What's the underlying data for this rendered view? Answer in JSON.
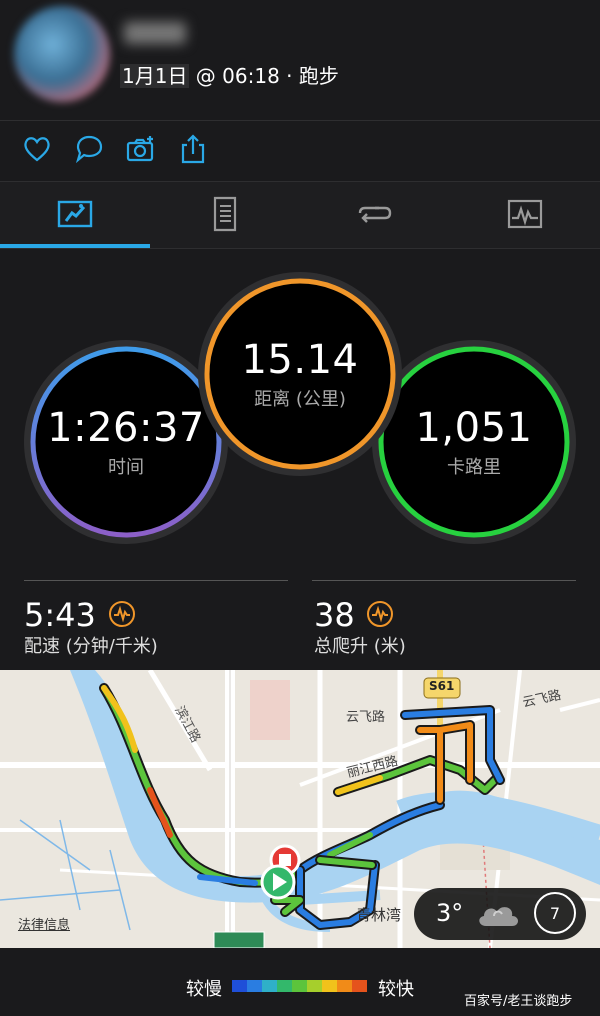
{
  "activity": {
    "date": "1月1日",
    "rest": " @ 06:18 · 跑步"
  },
  "metrics": {
    "time": {
      "value": "1:26:37",
      "label": "时间"
    },
    "distance": {
      "value": "15.14",
      "label": "距离 (公里)"
    },
    "calories": {
      "value": "1,051",
      "label": "卡路里"
    },
    "pace": {
      "value": "5:43",
      "label": "配速 (分钟/千米)"
    },
    "ascent": {
      "value": "38",
      "label": "总爬升 (米)"
    }
  },
  "map": {
    "labels": {
      "binjiang": "滨江路",
      "yunfei1": "云飞路",
      "yunfei2": "云飞路",
      "lijiang": "丽江西路",
      "qinglinwan": "青林湾",
      "s61": "S61",
      "legal": "法律信息"
    },
    "weather": {
      "temp": "3°",
      "icon": "cloud-icon",
      "compass_value": "7"
    }
  },
  "legend": {
    "slower": "较慢",
    "faster": "较快",
    "colors": [
      "#1f4fd8",
      "#2a7de1",
      "#2fb0c8",
      "#33b86b",
      "#5cc43c",
      "#a6cf2c",
      "#f1c21b",
      "#f18b18",
      "#e5531c"
    ]
  },
  "watermark": "百家号/老王谈跑步",
  "colors": {
    "accent": "#2aa8e6",
    "time_ring": "#4a8fe0",
    "distance_ring": "#f0962a",
    "calories_ring": "#27d13f"
  }
}
